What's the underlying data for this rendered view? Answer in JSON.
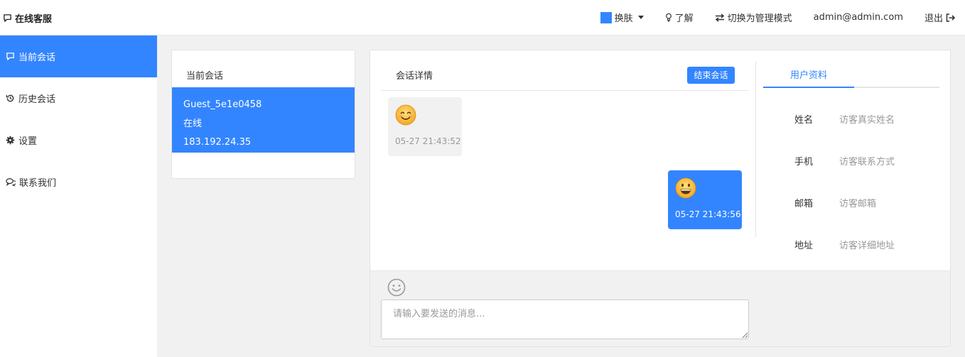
{
  "brand": {
    "title": "在线客服",
    "icon": "chat-bubble-icon"
  },
  "topnav": {
    "skin_label": "换肤",
    "skin_color": "#3385ff",
    "learn_label": "了解",
    "switch_label": "切换为管理模式",
    "user_email": "admin@admin.com",
    "logout_label": "退出"
  },
  "sidebar": {
    "items": [
      {
        "label": "当前会话",
        "icon": "chat-bubble-icon",
        "active": true
      },
      {
        "label": "历史会话",
        "icon": "history-icon",
        "active": false
      },
      {
        "label": "设置",
        "icon": "gear-icon",
        "active": false
      },
      {
        "label": "联系我们",
        "icon": "chat-bubbles-icon",
        "active": false
      }
    ]
  },
  "session_list": {
    "title": "当前会话",
    "sessions": [
      {
        "name": "Guest_5e1e0458",
        "status": "在线",
        "ip": "183.192.24.35"
      }
    ]
  },
  "chat": {
    "title": "会话详情",
    "end_button": "结束会话",
    "messages": [
      {
        "direction": "in",
        "emoji": "smiling-face-icon",
        "time": "05-27 21:43:52"
      },
      {
        "direction": "out",
        "emoji": "grinning-face-icon",
        "time": "05-27 21:43:56"
      }
    ],
    "input_placeholder": "请输入要发送的消息..."
  },
  "profile": {
    "tab_label": "用户资料",
    "fields": [
      {
        "label": "姓名",
        "placeholder": "访客真实姓名"
      },
      {
        "label": "手机",
        "placeholder": "访客联系方式"
      },
      {
        "label": "邮箱",
        "placeholder": "访客邮箱"
      },
      {
        "label": "地址",
        "placeholder": "访客详细地址"
      }
    ]
  },
  "colors": {
    "accent": "#3385ff",
    "background": "#f1f1f1"
  }
}
